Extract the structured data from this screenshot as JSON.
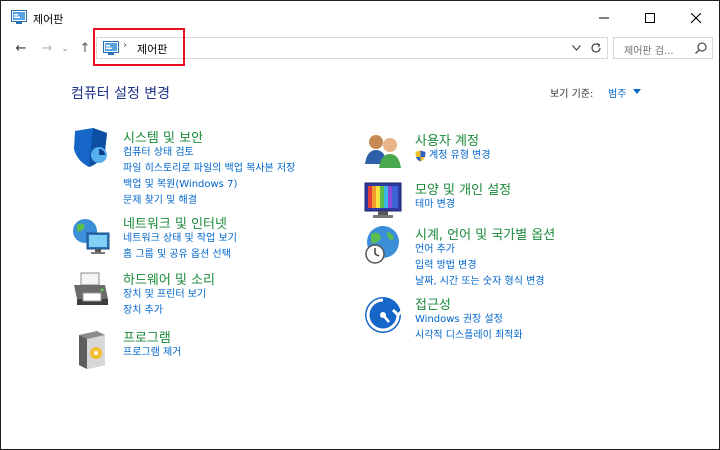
{
  "window": {
    "title": "제어판"
  },
  "navigation": {
    "back_glyph": "←",
    "forward_glyph": "→",
    "recent_glyph": "⌄",
    "up_glyph": "↑"
  },
  "address_bar": {
    "separator": "›",
    "path": "제어판"
  },
  "search": {
    "placeholder": "제어판 검..."
  },
  "content": {
    "title": "컴퓨터 설정 변경",
    "view_by_label": "보기 기준:",
    "view_by_value": "범주"
  },
  "categories": {
    "system_security": {
      "title": "시스템 및 보안",
      "links": [
        "컴퓨터 상태 검토",
        "파일 히스토리로 파일의 백업 복사본 저장",
        "백업 및 복원(Windows 7)",
        "문제 찾기 및 해결"
      ]
    },
    "network": {
      "title": "네트워크 및 인터넷",
      "links": [
        "네트워크 상태 및 작업 보기",
        "홈 그룹 및 공유 옵션 선택"
      ]
    },
    "hardware": {
      "title": "하드웨어 및 소리",
      "links": [
        "장치 및 프린터 보기",
        "장치 추가"
      ]
    },
    "programs": {
      "title": "프로그램",
      "links": [
        "프로그램 제거"
      ]
    },
    "user_accounts": {
      "title": "사용자 계정",
      "links": [
        "계정 유형 변경"
      ]
    },
    "appearance": {
      "title": "모양 및 개인 설정",
      "links": [
        "테마 변경"
      ]
    },
    "clock_region": {
      "title": "시계, 언어 및 국가별 옵션",
      "links": [
        "언어 추가",
        "입력 방법 변경",
        "날짜, 시간 또는 숫자 형식 변경"
      ]
    },
    "ease_of_access": {
      "title": "접근성",
      "links": [
        "Windows 권장 설정",
        "시각적 디스플레이 최적화"
      ]
    }
  },
  "colors": {
    "category_title": "#1a8a3a",
    "link": "#0066cc",
    "page_title": "#1e3287",
    "highlight_box": "#e81123"
  }
}
